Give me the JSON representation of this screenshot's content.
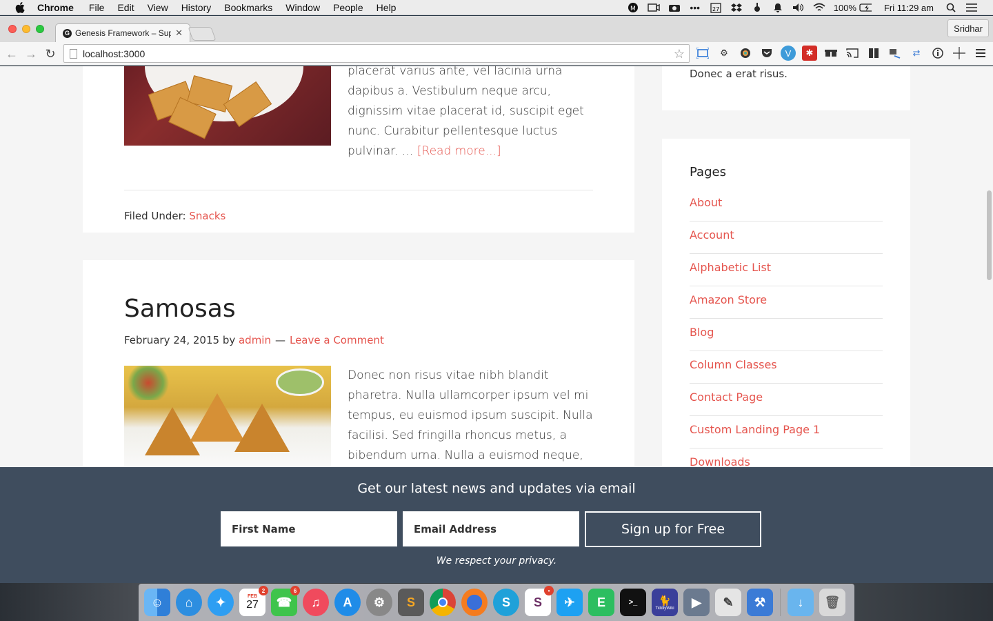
{
  "menubar": {
    "app_name": "Chrome",
    "items": [
      "File",
      "Edit",
      "View",
      "History",
      "Bookmarks",
      "Window",
      "People",
      "Help"
    ],
    "calendar_day": "27",
    "battery": "100%",
    "clock": "Fri 11:29 am",
    "status_icons": [
      "menu-extra-m-icon",
      "camera-icon",
      "video-icon",
      "more-icon",
      "calendar-icon",
      "dropbox-icon",
      "flux-icon",
      "notification-icon",
      "volume-icon",
      "wifi-icon",
      "battery-icon",
      "spotlight-icon",
      "notification-center-icon"
    ]
  },
  "browser": {
    "tab_title": "Genesis Framework – Supp",
    "tab_favicon": "G",
    "profile_name": "Sridhar",
    "url": "localhost:3000"
  },
  "post1": {
    "excerpt": "placerat varius ante, vel lacinia urna dapibus a. Vestibulum neque arcu, dignissim vitae placerat id, suscipit eget nunc. Curabitur pellentesque luctus pulvinar. … ",
    "read_more": "[Read more...]",
    "filed_label": "Filed Under: ",
    "category": "Snacks"
  },
  "post2": {
    "title": "Samosas",
    "date": "February 24, 2015",
    "by": " by ",
    "author": "admin",
    "separator": "—",
    "comment_link": "Leave a Comment",
    "excerpt": "Donec non risus vitae nibh blandit pharetra. Nulla ullamcorper ipsum vel mi tempus, eu euismod ipsum suscipit. Nulla facilisi. Sed fringilla rhoncus metus, a bibendum urna. Nulla a euismod neque, sollicitudin congue est."
  },
  "sidebar": {
    "top_text": "Donec a erat risus.",
    "pages_title": "Pages",
    "pages": [
      "About",
      "Account",
      "Alphabetic List",
      "Amazon Store",
      "Blog",
      "Column Classes",
      "Contact Page",
      "Custom Landing Page 1",
      "Downloads"
    ]
  },
  "signup": {
    "title": "Get our latest news and updates via email",
    "first_name_placeholder": "First Name",
    "email_placeholder": "Email Address",
    "button": "Sign up for Free",
    "privacy": "We respect your privacy."
  },
  "dock": {
    "calendar_month": "FEB",
    "calendar_day": "27",
    "badges": {
      "calendar": "2",
      "facetime": "6"
    },
    "tiddlywiki_label": "TiddlyWiki"
  },
  "colors": {
    "accent": "#e5554e",
    "signup_bg": "#3f4d5e",
    "page_bg": "#f5f5f5"
  }
}
